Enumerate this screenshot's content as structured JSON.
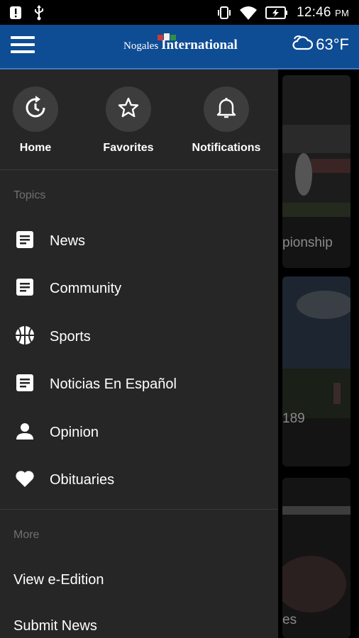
{
  "status_bar": {
    "time": "12:46",
    "ampm": "PM",
    "icons": [
      "alert-icon",
      "usb-icon",
      "vibrate-icon",
      "wifi-icon",
      "battery-charging-icon"
    ]
  },
  "app_bar": {
    "menu_icon": "hamburger-icon",
    "logo_word1": "Nogales",
    "logo_word2": "International",
    "weather_icon": "cloud-icon",
    "temperature": "63°F"
  },
  "drawer": {
    "quick_actions": [
      {
        "label": "Home",
        "icon": "home-refresh-icon"
      },
      {
        "label": "Favorites",
        "icon": "star-icon"
      },
      {
        "label": "Notifications",
        "icon": "bell-icon"
      }
    ],
    "topics_header": "Topics",
    "topics": [
      {
        "label": "News",
        "icon": "article-icon"
      },
      {
        "label": "Community",
        "icon": "article-icon"
      },
      {
        "label": "Sports",
        "icon": "basketball-icon"
      },
      {
        "label": "Noticias En Español",
        "icon": "article-icon"
      },
      {
        "label": "Opinion",
        "icon": "person-icon"
      },
      {
        "label": "Obituaries",
        "icon": "heart-icon"
      }
    ],
    "more_header": "More",
    "more_items": [
      {
        "label": "View e-Edition"
      },
      {
        "label": "Submit News"
      }
    ]
  },
  "background": {
    "card_texts": [
      "pionship",
      "189",
      "es"
    ]
  },
  "colors": {
    "app_bar": "#0e4c94",
    "drawer_bg": "#262626",
    "circle_bg": "#3d3d3d",
    "muted_text": "#707070"
  }
}
